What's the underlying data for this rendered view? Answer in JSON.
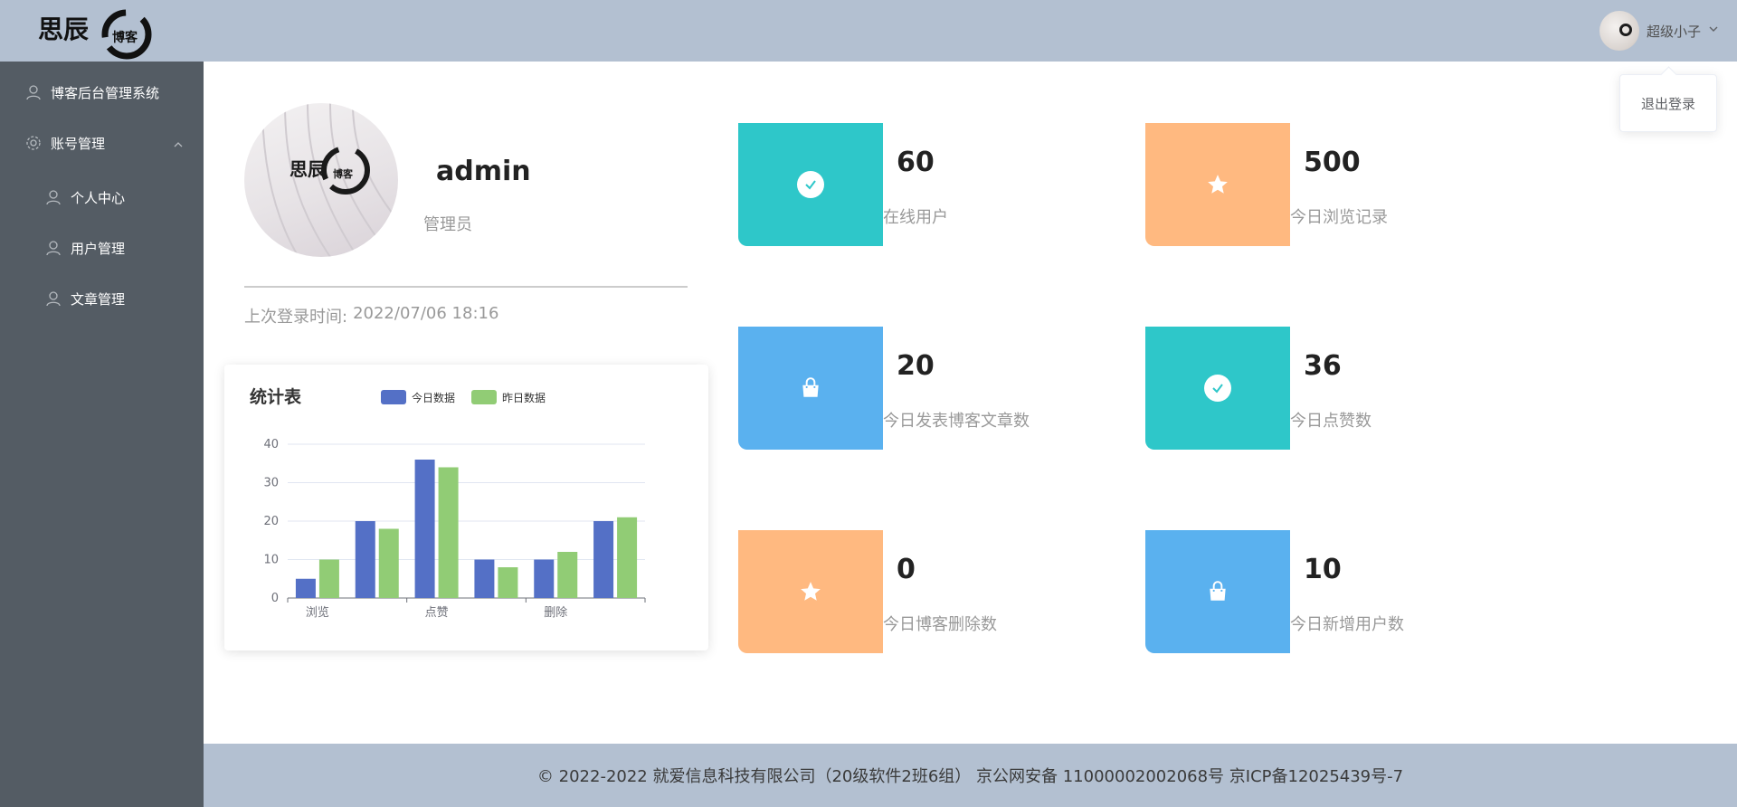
{
  "header": {
    "logo_alt": "思辰博客",
    "user_name": "超级小子",
    "dropdown_item": "退出登录"
  },
  "sidebar": {
    "items": [
      {
        "label": "博客后台管理系统",
        "icon": "user-icon"
      },
      {
        "label": "账号管理",
        "icon": "gear-icon",
        "expanded": true
      },
      {
        "label": "个人中心",
        "icon": "user-icon"
      },
      {
        "label": "用户管理",
        "icon": "user-icon"
      },
      {
        "label": "文章管理",
        "icon": "user-icon"
      }
    ]
  },
  "profile": {
    "username": "admin",
    "role": "管理员",
    "login_time_label": "上次登录时间:",
    "login_time_value": "2022/07/06 18:16"
  },
  "stats": [
    {
      "value": "60",
      "label": "在线用户",
      "color": "#2ec7c9",
      "icon": "check-circle-icon"
    },
    {
      "value": "500",
      "label": "今日浏览记录",
      "color": "#ffb980",
      "icon": "star-icon"
    },
    {
      "value": "20",
      "label": "今日发表博客文章数",
      "color": "#5ab1ef",
      "icon": "shopping-bag-icon"
    },
    {
      "value": "36",
      "label": "今日点赞数",
      "color": "#2ec7c9",
      "icon": "check-circle-icon"
    },
    {
      "value": "0",
      "label": "今日博客删除数",
      "color": "#ffb980",
      "icon": "star-icon"
    },
    {
      "value": "10",
      "label": "今日新增用户数",
      "color": "#5ab1ef",
      "icon": "shopping-bag-icon"
    }
  ],
  "chart_data": {
    "type": "bar",
    "title": "统计表",
    "categories": [
      "浏览",
      "",
      "点赞",
      "",
      "删除",
      ""
    ],
    "series": [
      {
        "name": "今日数据",
        "color": "#5470c6",
        "values": [
          5,
          20,
          36,
          10,
          10,
          20
        ]
      },
      {
        "name": "昨日数据",
        "color": "#91cc75",
        "values": [
          10,
          18,
          34,
          8,
          12,
          21
        ]
      }
    ],
    "yticks": [
      0,
      10,
      20,
      30,
      40
    ],
    "ylim": [
      0,
      40
    ],
    "legend": "top",
    "grid": true
  },
  "footer": {
    "text": "© 2022-2022 就爱信息科技有限公司（20级软件2班6组） 京公网安备 11000002002068号 京ICP备12025439号-7"
  }
}
